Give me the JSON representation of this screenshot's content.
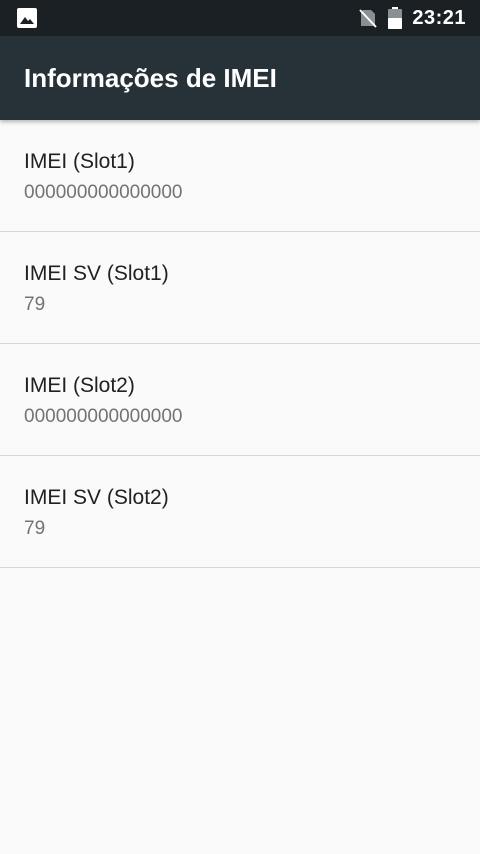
{
  "status_bar": {
    "time": "23:21",
    "left_icon": "image-icon",
    "right_icons": [
      "no-sim-icon",
      "battery-icon"
    ]
  },
  "app_bar": {
    "title": "Informações de IMEI",
    "background": "#263238"
  },
  "items": [
    {
      "title": "IMEI (Slot1)",
      "value": "000000000000000"
    },
    {
      "title": "IMEI SV (Slot1)",
      "value": "79"
    },
    {
      "title": "IMEI (Slot2)",
      "value": "000000000000000"
    },
    {
      "title": "IMEI SV (Slot2)",
      "value": "79"
    }
  ]
}
